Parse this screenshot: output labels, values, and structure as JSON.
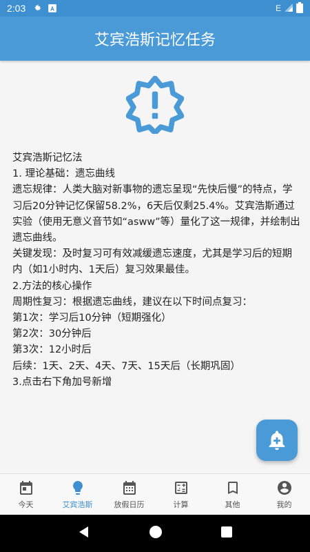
{
  "status_bar": {
    "time": "2:03",
    "network": "E"
  },
  "app_bar": {
    "title": "艾宾浩斯记忆任务"
  },
  "article": {
    "lines": [
      "艾宾浩斯记忆法",
      "1. 理论基础：遗忘曲线",
      "遗忘规律：人类大脑对新事物的遗忘呈现“先快后慢”的特点，学习后20分钟记忆保留58.2%，6天后仅剩25.4%。艾宾浩斯通过实验（使用无意义音节如“asww”等）量化了这一规律，并绘制出遗忘曲线。",
      "关键发现：及时复习可有效减缓遗忘速度，尤其是学习后的短期内（如1小时内、1天后）复习效果最佳。",
      "2.方法的核心操作",
      "周期性复习：根据遗忘曲线，建议在以下时间点复习：",
      "第1次：学习后10分钟（短期强化）",
      "第2次：30分钟后",
      "第3次：12小时后",
      "后续：1天、2天、4天、7天、15天后（长期巩固）",
      "3.点击右下角加号新增"
    ]
  },
  "bottom_nav": {
    "items": [
      {
        "label": "今天",
        "icon": "calendar-day-icon"
      },
      {
        "label": "艾宾浩斯",
        "icon": "lightbulb-icon"
      },
      {
        "label": "放假日历",
        "icon": "calendar-month-icon"
      },
      {
        "label": "计算",
        "icon": "calculator-icon"
      },
      {
        "label": "其他",
        "icon": "bookmark-icon"
      },
      {
        "label": "我的",
        "icon": "account-icon"
      }
    ],
    "active_index": 1
  },
  "colors": {
    "primary": "#4a9ad8",
    "status_bar": "#3d8fd0",
    "active": "#3d8fd0",
    "text": "#222222"
  }
}
